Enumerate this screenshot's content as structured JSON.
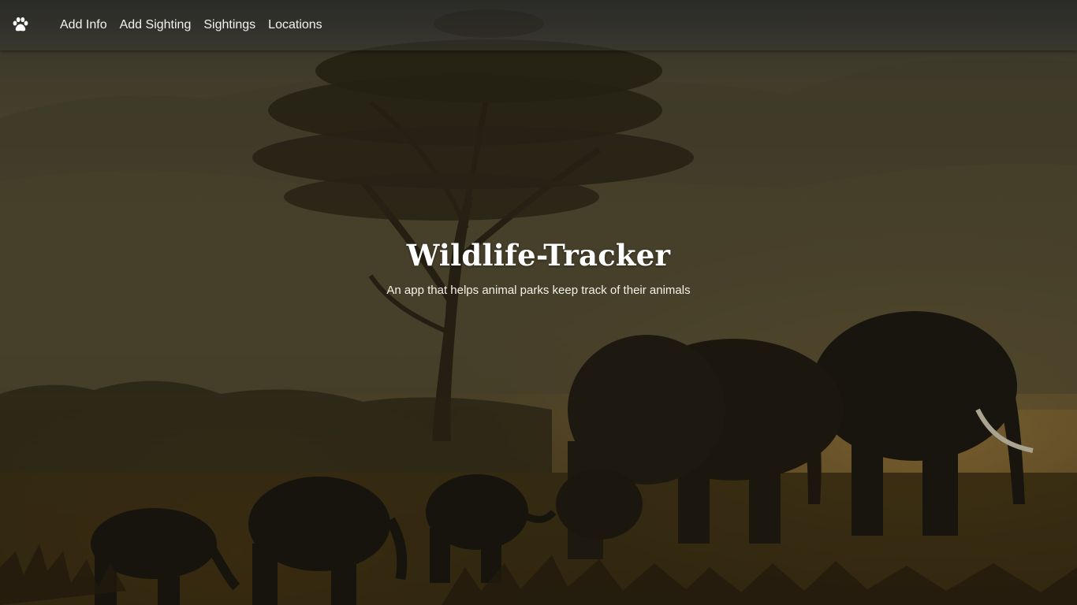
{
  "nav": {
    "brand_icon": "paw-icon",
    "links": [
      "Add Info",
      "Add Sighting",
      "Sightings",
      "Locations"
    ]
  },
  "hero": {
    "title": "Wildlife-Tracker",
    "subtitle": "An app that helps animal parks keep track of their animals",
    "background": "savanna-elephants-acacia-photo"
  },
  "colors": {
    "nav_text": "#f2f2f2",
    "title": "#ffffff"
  }
}
